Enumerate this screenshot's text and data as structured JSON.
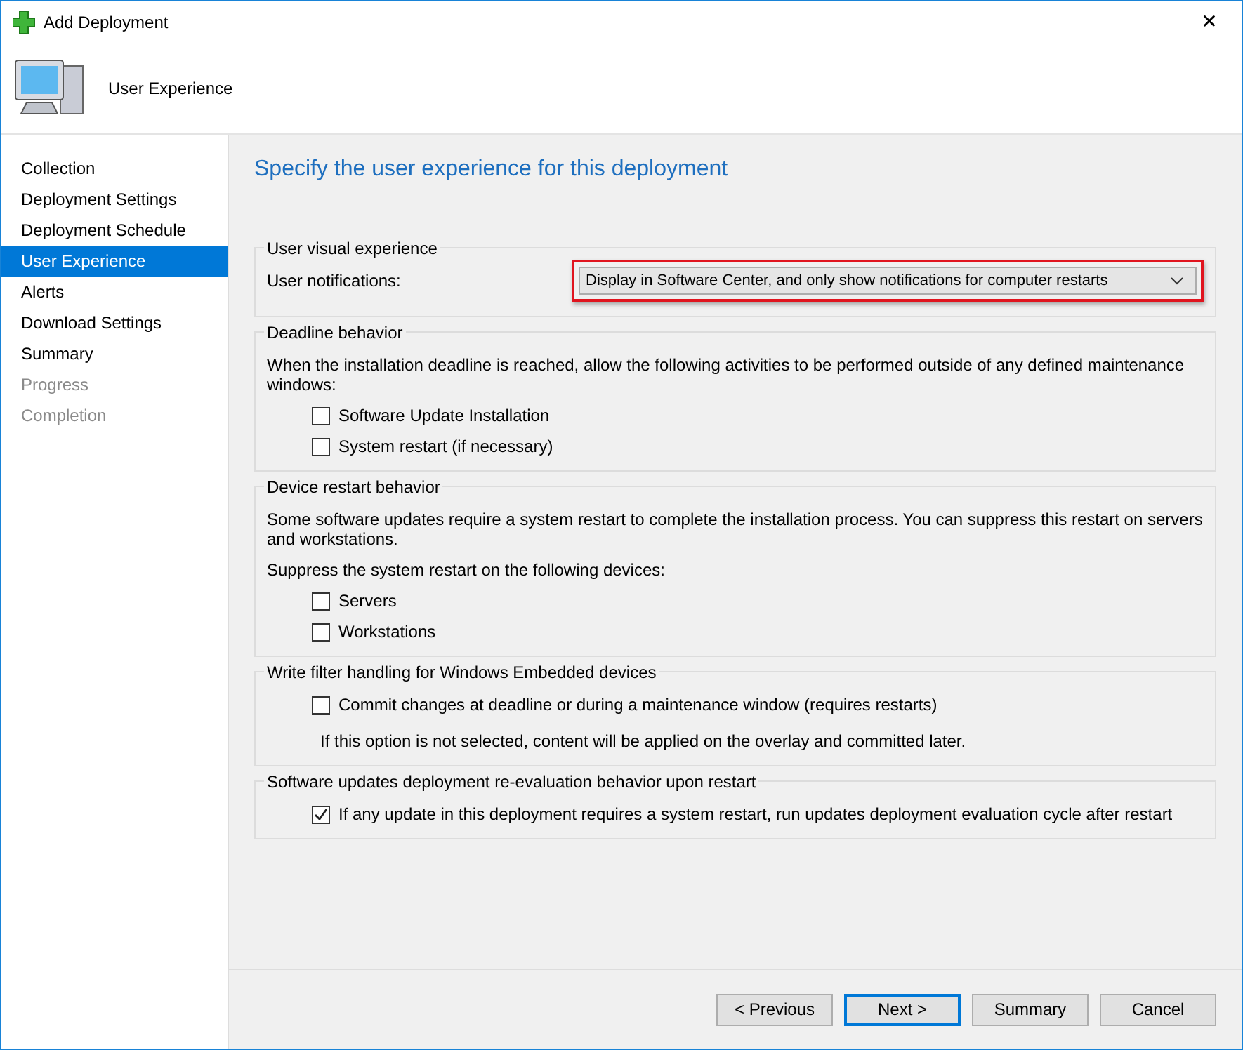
{
  "window": {
    "title": "Add Deployment",
    "close": "✕"
  },
  "header": {
    "title": "User Experience"
  },
  "sidebar": {
    "items": [
      {
        "label": "Collection",
        "selected": false,
        "disabled": false
      },
      {
        "label": "Deployment Settings",
        "selected": false,
        "disabled": false
      },
      {
        "label": "Deployment Schedule",
        "selected": false,
        "disabled": false
      },
      {
        "label": "User Experience",
        "selected": true,
        "disabled": false
      },
      {
        "label": "Alerts",
        "selected": false,
        "disabled": false
      },
      {
        "label": "Download Settings",
        "selected": false,
        "disabled": false
      },
      {
        "label": "Summary",
        "selected": false,
        "disabled": false
      },
      {
        "label": "Progress",
        "selected": false,
        "disabled": true
      },
      {
        "label": "Completion",
        "selected": false,
        "disabled": true
      }
    ]
  },
  "page_title": "Specify the user experience for this deployment",
  "groups": [
    {
      "title": "User visual experience",
      "items": [
        {
          "kind": "dropdown",
          "label": "User notifications:",
          "value": "Display in Software Center, and only show notifications for computer restarts",
          "highlighted": true
        }
      ]
    },
    {
      "title": "Deadline behavior",
      "items": [
        {
          "kind": "text",
          "text": "When the installation deadline is reached, allow the following activities to be performed outside of any defined maintenance windows:"
        },
        {
          "kind": "checkbox",
          "label": "Software Update Installation",
          "checked": false
        },
        {
          "kind": "checkbox",
          "label": "System restart (if necessary)",
          "checked": false
        }
      ]
    },
    {
      "title": "Device restart behavior",
      "items": [
        {
          "kind": "text",
          "text": "Some software updates require a system restart to complete the installation process. You can suppress this restart on servers and workstations."
        },
        {
          "kind": "text",
          "text": "Suppress the system restart on the following devices:"
        },
        {
          "kind": "checkbox",
          "label": "Servers",
          "checked": false
        },
        {
          "kind": "checkbox",
          "label": "Workstations",
          "checked": false
        }
      ]
    },
    {
      "title": "Write filter handling for Windows Embedded devices",
      "items": [
        {
          "kind": "checkbox",
          "label": "Commit changes at deadline or during a maintenance window (requires restarts)",
          "checked": false
        },
        {
          "kind": "note",
          "text": "If this option is not selected, content will be applied on the overlay and committed later."
        }
      ]
    },
    {
      "title": "Software updates deployment re-evaluation behavior upon restart",
      "items": [
        {
          "kind": "checkbox",
          "label": "If any update in this deployment requires a system restart, run updates deployment evaluation cycle after restart",
          "checked": true
        }
      ]
    }
  ],
  "buttons": [
    {
      "label": "< Previous",
      "default": false
    },
    {
      "label": "Next >",
      "default": true
    },
    {
      "label": "Summary",
      "default": false
    },
    {
      "label": "Cancel",
      "default": false
    }
  ]
}
